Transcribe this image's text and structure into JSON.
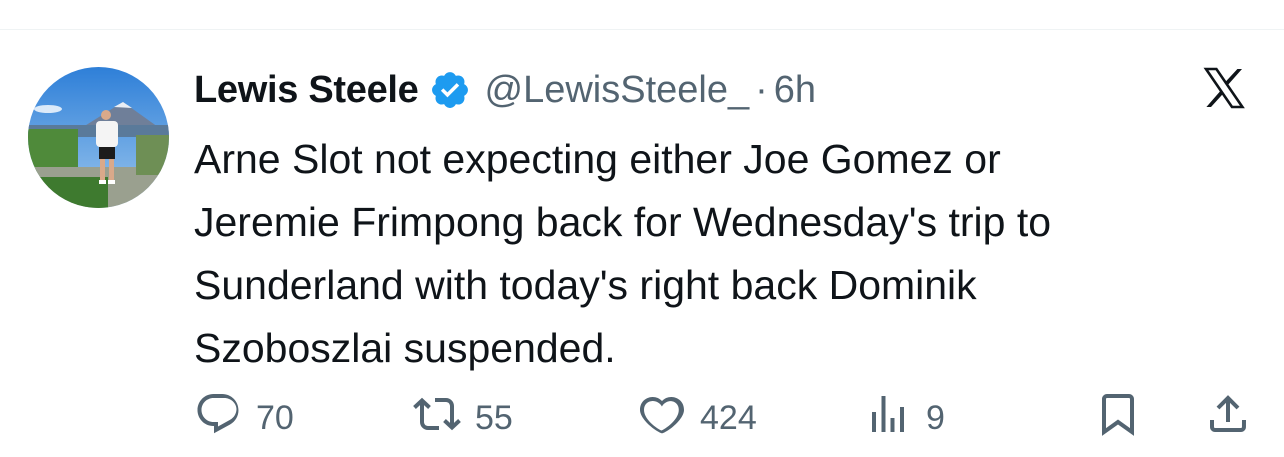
{
  "tweet": {
    "author": {
      "display_name": "Lewis Steele",
      "handle": "@LewisSteele_",
      "verified": true
    },
    "separator": "·",
    "time": "6h",
    "text": "Arne Slot not expecting either Joe Gomez or\nJeremie Frimpong back for Wednesday's trip to\nSunderland with today's right back  Dominik\nSzoboszlai suspended.",
    "stats": {
      "replies": "70",
      "retweets": "55",
      "likes": "424",
      "views": "9"
    }
  },
  "icons": {
    "brand": "x-logo-icon",
    "verified": "verified-badge-icon",
    "reply": "reply-icon",
    "retweet": "retweet-icon",
    "like": "heart-icon",
    "views": "views-icon",
    "bookmark": "bookmark-icon",
    "share": "share-icon"
  },
  "colors": {
    "text": "#0f1419",
    "secondary": "#536471",
    "verified": "#1d9bf0",
    "divider": "#eff3f4"
  }
}
